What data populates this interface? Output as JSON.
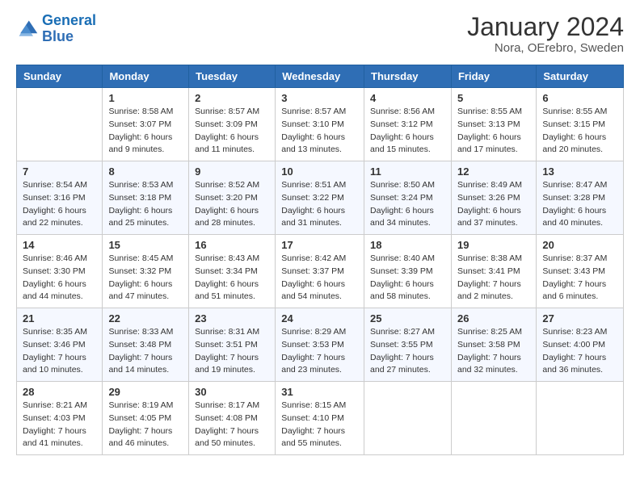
{
  "logo": {
    "line1": "General",
    "line2": "Blue"
  },
  "title": "January 2024",
  "subtitle": "Nora, OErebro, Sweden",
  "weekdays": [
    "Sunday",
    "Monday",
    "Tuesday",
    "Wednesday",
    "Thursday",
    "Friday",
    "Saturday"
  ],
  "weeks": [
    [
      {
        "day": "",
        "sunrise": "",
        "sunset": "",
        "daylight": ""
      },
      {
        "day": "1",
        "sunrise": "Sunrise: 8:58 AM",
        "sunset": "Sunset: 3:07 PM",
        "daylight": "Daylight: 6 hours and 9 minutes."
      },
      {
        "day": "2",
        "sunrise": "Sunrise: 8:57 AM",
        "sunset": "Sunset: 3:09 PM",
        "daylight": "Daylight: 6 hours and 11 minutes."
      },
      {
        "day": "3",
        "sunrise": "Sunrise: 8:57 AM",
        "sunset": "Sunset: 3:10 PM",
        "daylight": "Daylight: 6 hours and 13 minutes."
      },
      {
        "day": "4",
        "sunrise": "Sunrise: 8:56 AM",
        "sunset": "Sunset: 3:12 PM",
        "daylight": "Daylight: 6 hours and 15 minutes."
      },
      {
        "day": "5",
        "sunrise": "Sunrise: 8:55 AM",
        "sunset": "Sunset: 3:13 PM",
        "daylight": "Daylight: 6 hours and 17 minutes."
      },
      {
        "day": "6",
        "sunrise": "Sunrise: 8:55 AM",
        "sunset": "Sunset: 3:15 PM",
        "daylight": "Daylight: 6 hours and 20 minutes."
      }
    ],
    [
      {
        "day": "7",
        "sunrise": "Sunrise: 8:54 AM",
        "sunset": "Sunset: 3:16 PM",
        "daylight": "Daylight: 6 hours and 22 minutes."
      },
      {
        "day": "8",
        "sunrise": "Sunrise: 8:53 AM",
        "sunset": "Sunset: 3:18 PM",
        "daylight": "Daylight: 6 hours and 25 minutes."
      },
      {
        "day": "9",
        "sunrise": "Sunrise: 8:52 AM",
        "sunset": "Sunset: 3:20 PM",
        "daylight": "Daylight: 6 hours and 28 minutes."
      },
      {
        "day": "10",
        "sunrise": "Sunrise: 8:51 AM",
        "sunset": "Sunset: 3:22 PM",
        "daylight": "Daylight: 6 hours and 31 minutes."
      },
      {
        "day": "11",
        "sunrise": "Sunrise: 8:50 AM",
        "sunset": "Sunset: 3:24 PM",
        "daylight": "Daylight: 6 hours and 34 minutes."
      },
      {
        "day": "12",
        "sunrise": "Sunrise: 8:49 AM",
        "sunset": "Sunset: 3:26 PM",
        "daylight": "Daylight: 6 hours and 37 minutes."
      },
      {
        "day": "13",
        "sunrise": "Sunrise: 8:47 AM",
        "sunset": "Sunset: 3:28 PM",
        "daylight": "Daylight: 6 hours and 40 minutes."
      }
    ],
    [
      {
        "day": "14",
        "sunrise": "Sunrise: 8:46 AM",
        "sunset": "Sunset: 3:30 PM",
        "daylight": "Daylight: 6 hours and 44 minutes."
      },
      {
        "day": "15",
        "sunrise": "Sunrise: 8:45 AM",
        "sunset": "Sunset: 3:32 PM",
        "daylight": "Daylight: 6 hours and 47 minutes."
      },
      {
        "day": "16",
        "sunrise": "Sunrise: 8:43 AM",
        "sunset": "Sunset: 3:34 PM",
        "daylight": "Daylight: 6 hours and 51 minutes."
      },
      {
        "day": "17",
        "sunrise": "Sunrise: 8:42 AM",
        "sunset": "Sunset: 3:37 PM",
        "daylight": "Daylight: 6 hours and 54 minutes."
      },
      {
        "day": "18",
        "sunrise": "Sunrise: 8:40 AM",
        "sunset": "Sunset: 3:39 PM",
        "daylight": "Daylight: 6 hours and 58 minutes."
      },
      {
        "day": "19",
        "sunrise": "Sunrise: 8:38 AM",
        "sunset": "Sunset: 3:41 PM",
        "daylight": "Daylight: 7 hours and 2 minutes."
      },
      {
        "day": "20",
        "sunrise": "Sunrise: 8:37 AM",
        "sunset": "Sunset: 3:43 PM",
        "daylight": "Daylight: 7 hours and 6 minutes."
      }
    ],
    [
      {
        "day": "21",
        "sunrise": "Sunrise: 8:35 AM",
        "sunset": "Sunset: 3:46 PM",
        "daylight": "Daylight: 7 hours and 10 minutes."
      },
      {
        "day": "22",
        "sunrise": "Sunrise: 8:33 AM",
        "sunset": "Sunset: 3:48 PM",
        "daylight": "Daylight: 7 hours and 14 minutes."
      },
      {
        "day": "23",
        "sunrise": "Sunrise: 8:31 AM",
        "sunset": "Sunset: 3:51 PM",
        "daylight": "Daylight: 7 hours and 19 minutes."
      },
      {
        "day": "24",
        "sunrise": "Sunrise: 8:29 AM",
        "sunset": "Sunset: 3:53 PM",
        "daylight": "Daylight: 7 hours and 23 minutes."
      },
      {
        "day": "25",
        "sunrise": "Sunrise: 8:27 AM",
        "sunset": "Sunset: 3:55 PM",
        "daylight": "Daylight: 7 hours and 27 minutes."
      },
      {
        "day": "26",
        "sunrise": "Sunrise: 8:25 AM",
        "sunset": "Sunset: 3:58 PM",
        "daylight": "Daylight: 7 hours and 32 minutes."
      },
      {
        "day": "27",
        "sunrise": "Sunrise: 8:23 AM",
        "sunset": "Sunset: 4:00 PM",
        "daylight": "Daylight: 7 hours and 36 minutes."
      }
    ],
    [
      {
        "day": "28",
        "sunrise": "Sunrise: 8:21 AM",
        "sunset": "Sunset: 4:03 PM",
        "daylight": "Daylight: 7 hours and 41 minutes."
      },
      {
        "day": "29",
        "sunrise": "Sunrise: 8:19 AM",
        "sunset": "Sunset: 4:05 PM",
        "daylight": "Daylight: 7 hours and 46 minutes."
      },
      {
        "day": "30",
        "sunrise": "Sunrise: 8:17 AM",
        "sunset": "Sunset: 4:08 PM",
        "daylight": "Daylight: 7 hours and 50 minutes."
      },
      {
        "day": "31",
        "sunrise": "Sunrise: 8:15 AM",
        "sunset": "Sunset: 4:10 PM",
        "daylight": "Daylight: 7 hours and 55 minutes."
      },
      {
        "day": "",
        "sunrise": "",
        "sunset": "",
        "daylight": ""
      },
      {
        "day": "",
        "sunrise": "",
        "sunset": "",
        "daylight": ""
      },
      {
        "day": "",
        "sunrise": "",
        "sunset": "",
        "daylight": ""
      }
    ]
  ]
}
